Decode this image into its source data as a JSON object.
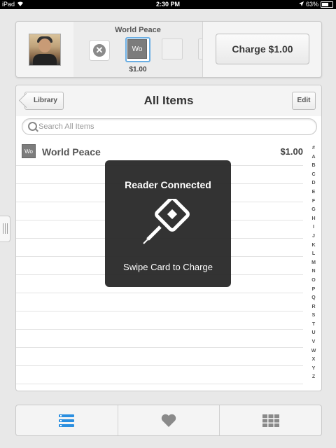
{
  "status_bar": {
    "device": "iPad",
    "time": "2:30 PM",
    "battery": "63%",
    "battery_level": 0.63
  },
  "cart": {
    "title": "World Peace",
    "item_tile": "Wo",
    "price": "$1.00",
    "charge_label": "Charge $1.00"
  },
  "library": {
    "back_label": "Library",
    "title": "All Items",
    "edit_label": "Edit",
    "search_placeholder": "Search All Items",
    "items": [
      {
        "thumb": "Wo",
        "name": "World Peace",
        "price": "$1.00"
      }
    ],
    "index_letters": [
      "#",
      "A",
      "B",
      "C",
      "D",
      "E",
      "F",
      "G",
      "H",
      "I",
      "J",
      "K",
      "L",
      "M",
      "N",
      "O",
      "P",
      "Q",
      "R",
      "S",
      "T",
      "U",
      "V",
      "W",
      "X",
      "Y",
      "Z"
    ]
  },
  "overlay": {
    "title": "Reader Connected",
    "subtitle": "Swipe Card to Charge"
  },
  "tabs": [
    {
      "icon": "list-icon",
      "active": true
    },
    {
      "icon": "heart-icon",
      "active": false
    },
    {
      "icon": "grid-icon",
      "active": false
    }
  ],
  "colors": {
    "accent": "#2b8fe0",
    "overlay": "#282828",
    "icon_gray": "#8a8a8a"
  }
}
